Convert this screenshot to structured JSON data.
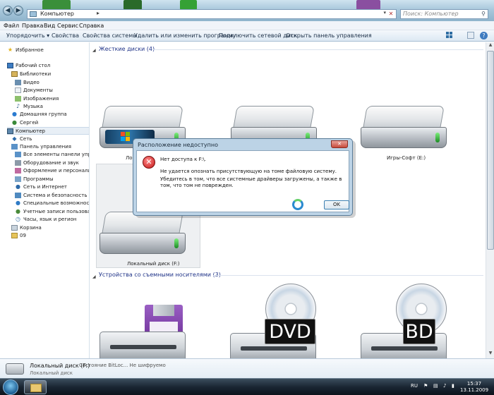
{
  "address": {
    "path": "Компьютер",
    "search_placeholder": "Поиск: Компьютер"
  },
  "menu": [
    "Файл",
    "Правка",
    "Вид",
    "Сервис",
    "Справка"
  ],
  "toolbar": [
    "Упорядочить ▾",
    "Свойства",
    "Свойства системы",
    "Удалить или изменить программу",
    "Подключить сетевой диск",
    "Открыть панель управления"
  ],
  "nav": {
    "favorites": "Избранное",
    "desktop": "Рабочий стол",
    "libraries": "Библиотеки",
    "video": "Видео",
    "documents": "Документы",
    "images": "Изображения",
    "music": "Музыка",
    "homegroup": "Домашняя группа",
    "user": "Сергей",
    "computer": "Компьютер",
    "network": "Сеть",
    "control_panel": "Панель управления",
    "all_items": "Все элементы панели управле",
    "hardware": "Оборудование и звук",
    "appearance": "Оформление и персонализаци",
    "programs": "Программы",
    "net_internet": "Сеть и Интернет",
    "security": "Система и безопасность",
    "accessibility": "Специальные возможности",
    "accounts": "Учетные записи пользователей",
    "clock_region": "Часы, язык и регион",
    "recycle": "Корзина",
    "folder09": "09"
  },
  "groups": {
    "hard_disks": "Жесткие диски (4)",
    "removable": "Устройства со съемными носителями (3)"
  },
  "drives": {
    "c_label": "Ло",
    "e_label": "Игры-Софт (E:)",
    "f_label": "Локальный диск (F:)",
    "dvd": "DVD",
    "bd": "BD"
  },
  "dialog": {
    "title": "Расположение недоступно",
    "close": "✕",
    "line1": "Нет доступа к F:\\.",
    "line2": "Не удается опознать присутствующую на томе файловую систему.",
    "line3": "Убедитесь в том, что все системные драйверы загружены, а также в том, что том не поврежден.",
    "ok": "OK"
  },
  "details": {
    "name": "Локальный диск (F:)",
    "bitlocker": "Состояние BitLoc... Не шифруемо",
    "type": "Локальный диск"
  },
  "taskbar": {
    "lang": "RU",
    "time": "15:37",
    "date": "13.11.2009"
  },
  "colors": {
    "group_header": "#1e3287",
    "dialog_frame": "#bcd3e6",
    "error_red": "#c51616"
  }
}
